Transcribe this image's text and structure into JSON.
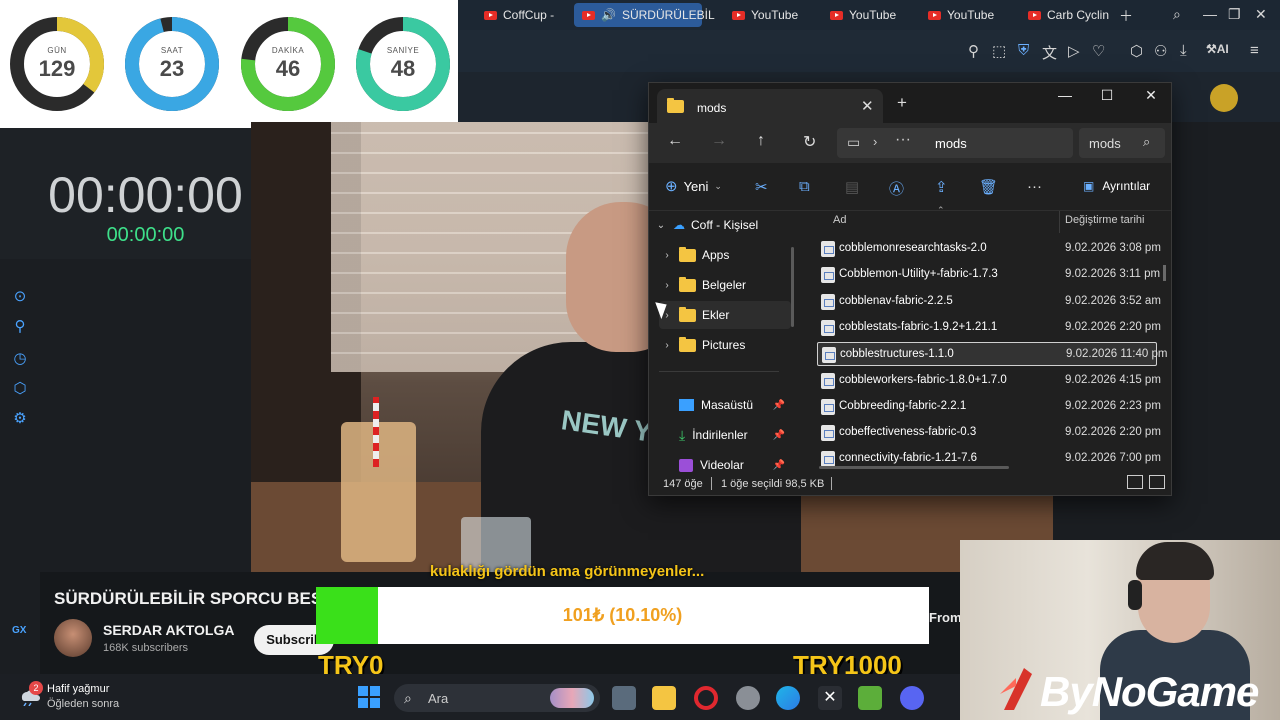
{
  "browser": {
    "tabs": [
      {
        "label": "CoffCup -",
        "active": false
      },
      {
        "label": "SÜRDÜRÜLEBİL",
        "active": true
      },
      {
        "label": "YouTube",
        "active": false
      },
      {
        "label": "YouTube",
        "active": false
      },
      {
        "label": "YouTube",
        "active": false
      },
      {
        "label": "Carb Cyclin",
        "active": false
      }
    ],
    "ai_label": "AI"
  },
  "countdown": {
    "items": [
      {
        "label": "GÜN",
        "value": "129",
        "color": "#e3c73a"
      },
      {
        "label": "SAAT",
        "value": "23",
        "color": "#3aa7e3"
      },
      {
        "label": "DAKİKA",
        "value": "46",
        "color": "#55c93e"
      },
      {
        "label": "SANİYE",
        "value": "48",
        "color": "#3ac9a1"
      }
    ]
  },
  "stopwatch": {
    "main": "00:00:00",
    "sub": "00:00:00"
  },
  "video": {
    "subtitle": "kulaklığı gördün ama görünmeyenler...",
    "shirt_text": "NEW YO",
    "title": "SÜRDÜRÜLEBİLİR SPORCU BES",
    "channel": "SERDAR AKTOLGA",
    "subscribers": "168K subscribers",
    "subscribe_label": "Subscrib"
  },
  "donation_goal": {
    "text": "101₺ (10.10%)",
    "progress_fraction": 0.101,
    "min_label": "TRY0",
    "max_label": "TRY1000",
    "fill_color": "#3ae01a"
  },
  "overlay": {
    "from_label": "From",
    "left_mini_label": "GX",
    "brand": "ByNoGame"
  },
  "taskbar": {
    "weather_title": "Hafif yağmur",
    "weather_sub": "Öğleden sonra",
    "weather_badge": "2",
    "search_placeholder": "Ara"
  },
  "explorer": {
    "tab_title": "mods",
    "address": "mods",
    "search_text": "mods",
    "new_label": "Yeni",
    "details_label": "Ayrıntılar",
    "nav_items": [
      {
        "label": "Coff - Kişisel",
        "expanded": true
      },
      {
        "label": "Apps"
      },
      {
        "label": "Belgeler"
      },
      {
        "label": "Ekler"
      },
      {
        "label": "Pictures"
      },
      {
        "label": "Masaüstü",
        "pinned": true
      },
      {
        "label": "İndirilenler",
        "pinned": true
      },
      {
        "label": "Videolar",
        "pinned": true
      }
    ],
    "columns": {
      "name": "Ad",
      "date": "Değiştirme tarihi"
    },
    "files": [
      {
        "name": "cobblemonresearchtasks-2.0",
        "date": "9.02.2026 3:08 pm"
      },
      {
        "name": "Cobblemon-Utility+-fabric-1.7.3",
        "date": "9.02.2026 3:11 pm"
      },
      {
        "name": "cobblenav-fabric-2.2.5",
        "date": "9.02.2026 3:52 am"
      },
      {
        "name": "cobblestats-fabric-1.9.2+1.21.1",
        "date": "9.02.2026 2:20 pm"
      },
      {
        "name": "cobblestructures-1.1.0",
        "date": "9.02.2026 11:40 pm",
        "selected": true
      },
      {
        "name": "cobbleworkers-fabric-1.8.0+1.7.0",
        "date": "9.02.2026 4:15 pm"
      },
      {
        "name": "Cobbreeding-fabric-2.2.1",
        "date": "9.02.2026 2:23 pm"
      },
      {
        "name": "cobeffectiveness-fabric-0.3",
        "date": "9.02.2026 2:20 pm"
      },
      {
        "name": "connectivity-fabric-1.21-7.6",
        "date": "9.02.2026 7:00 pm"
      }
    ],
    "status_count": "147 öğe",
    "status_selection": "1 öğe seçildi  98,5 KB"
  }
}
